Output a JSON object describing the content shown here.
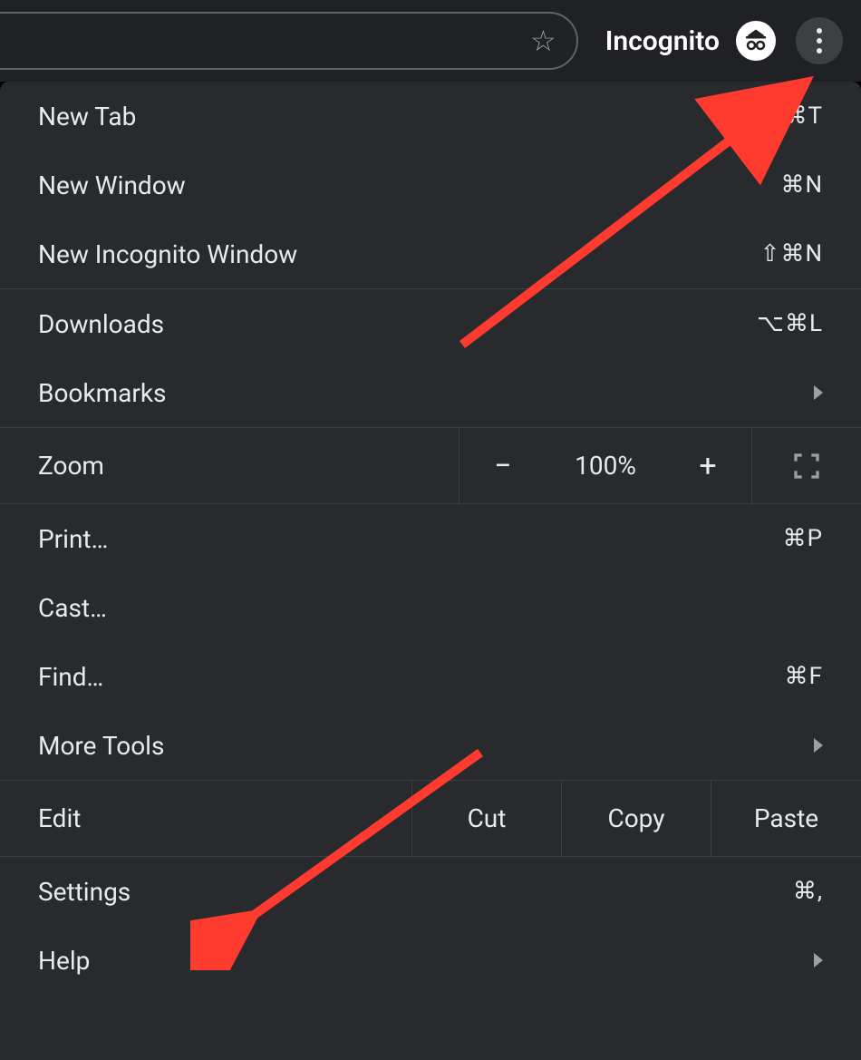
{
  "topbar": {
    "mode_label": "Incognito"
  },
  "menu": {
    "group1": [
      {
        "label": "New Tab",
        "shortcut": "⌘T"
      },
      {
        "label": "New Window",
        "shortcut": "⌘N"
      },
      {
        "label": "New Incognito Window",
        "shortcut": "⇧⌘N"
      }
    ],
    "group2": [
      {
        "label": "Downloads",
        "shortcut": "⌥⌘L"
      },
      {
        "label": "Bookmarks",
        "submenu": true
      }
    ],
    "zoom": {
      "label": "Zoom",
      "value": "100%",
      "minus": "−",
      "plus": "+"
    },
    "group3": [
      {
        "label": "Print…",
        "shortcut": "⌘P"
      },
      {
        "label": "Cast…"
      },
      {
        "label": "Find…",
        "shortcut": "⌘F"
      },
      {
        "label": "More Tools",
        "submenu": true
      }
    ],
    "edit": {
      "label": "Edit",
      "cut": "Cut",
      "copy": "Copy",
      "paste": "Paste"
    },
    "group4": [
      {
        "label": "Settings",
        "shortcut": "⌘,"
      },
      {
        "label": "Help",
        "submenu": true
      }
    ]
  }
}
